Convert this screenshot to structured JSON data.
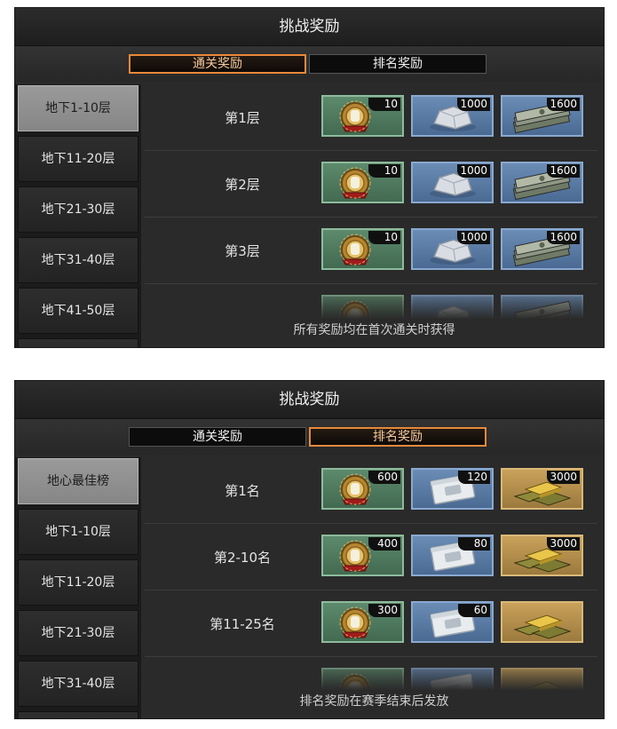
{
  "panels": [
    {
      "title": "挑战奖励",
      "tabs": [
        {
          "label": "通关奖励",
          "active": true
        },
        {
          "label": "排名奖励",
          "active": false
        }
      ],
      "sidebar": [
        "地下1-10层",
        "地下11-20层",
        "地下21-30层",
        "地下31-40层",
        "地下41-50层"
      ],
      "selected_sidebar": 0,
      "rows": [
        {
          "label": "第1层",
          "rewards": [
            {
              "type": "medal-icon",
              "color": "green",
              "qty": "10"
            },
            {
              "type": "ore-icon",
              "color": "blue",
              "qty": "1000"
            },
            {
              "type": "cash-icon",
              "color": "blue",
              "qty": "1600"
            }
          ]
        },
        {
          "label": "第2层",
          "rewards": [
            {
              "type": "medal-icon",
              "color": "green",
              "qty": "10"
            },
            {
              "type": "ore-icon",
              "color": "blue",
              "qty": "1000"
            },
            {
              "type": "cash-icon",
              "color": "blue",
              "qty": "1600"
            }
          ]
        },
        {
          "label": "第3层",
          "rewards": [
            {
              "type": "medal-icon",
              "color": "green",
              "qty": "10"
            },
            {
              "type": "ore-icon",
              "color": "blue",
              "qty": "1000"
            },
            {
              "type": "cash-icon",
              "color": "blue",
              "qty": "1600"
            }
          ]
        }
      ],
      "footer_note": "所有奖励均在首次通关时获得"
    },
    {
      "title": "挑战奖励",
      "tabs": [
        {
          "label": "通关奖励",
          "active": false
        },
        {
          "label": "排名奖励",
          "active": true
        }
      ],
      "sidebar": [
        "地心最佳榜",
        "地下1-10层",
        "地下11-20层",
        "地下21-30层",
        "地下31-40层"
      ],
      "selected_sidebar": 0,
      "rows": [
        {
          "label": "第1名",
          "rewards": [
            {
              "type": "medal-icon",
              "color": "green",
              "qty": "600"
            },
            {
              "type": "packet-icon",
              "color": "blue",
              "qty": "120"
            },
            {
              "type": "gold-bars-icon",
              "color": "gold",
              "qty": "3000"
            }
          ]
        },
        {
          "label": "第2-10名",
          "rewards": [
            {
              "type": "medal-icon",
              "color": "green",
              "qty": "400"
            },
            {
              "type": "packet-icon",
              "color": "blue",
              "qty": "80"
            },
            {
              "type": "gold-bars-icon",
              "color": "gold",
              "qty": "3000"
            }
          ]
        },
        {
          "label": "第11-25名",
          "rewards": [
            {
              "type": "medal-icon",
              "color": "green",
              "qty": "300"
            },
            {
              "type": "packet-icon",
              "color": "blue",
              "qty": "60"
            },
            {
              "type": "gold-bars-icon",
              "color": "gold",
              "qty": ""
            }
          ]
        }
      ],
      "footer_note": "排名奖励在赛季结束后发放"
    }
  ],
  "colors": {
    "tab_active_border": "#e8893a",
    "green_tile": "#5d8a6c",
    "blue_tile": "#6a8cb5",
    "gold_tile": "#c9a15a"
  }
}
